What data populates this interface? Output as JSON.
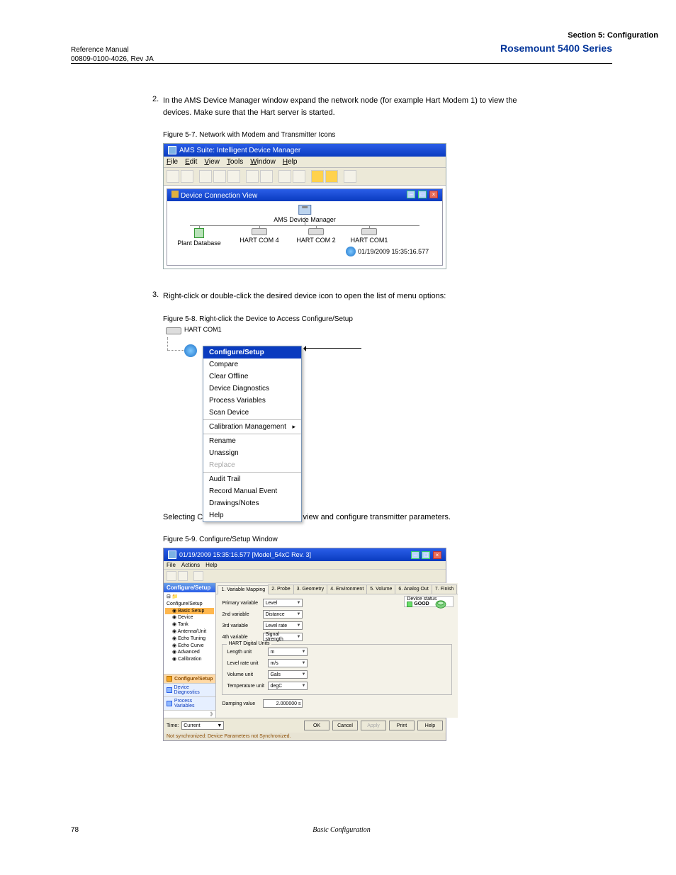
{
  "header": {
    "manual": "Reference Manual",
    "docid": "00809-0100-4026, Rev JA",
    "brand": "Rosemount 5400 Series",
    "section": "Section 5: Configuration"
  },
  "body": {
    "step2": "2.",
    "p1": "In the AMS Device Manager window expand the network node (for example Hart Modem 1) to view the devices. Make sure that the Hart server is started.",
    "figlabel1": "Figure 5-7. Network with Modem and Transmitter Icons",
    "step3": "3.",
    "p2": "Right-click or double-click the desired device icon to open the list of menu options:",
    "figlabel2": "Figure 5-8. Right-click the Device to Access Configure/Setup",
    "p3": "Selecting Configure/Setup allows you to view and configure transmitter parameters.",
    "figlabel3": "Figure 5-9. Configure/Setup Window"
  },
  "fig1": {
    "title": "AMS Suite: Intelligent Device Manager",
    "menus": [
      "File",
      "Edit",
      "View",
      "Tools",
      "Window",
      "Help"
    ],
    "inner_title": "Device Connection View",
    "root": "AMS Device Manager",
    "nodes": {
      "plantdb": "Plant Database",
      "com4": "HART COM 4",
      "com2": "HART COM 2",
      "com1": "HART COM1"
    },
    "device_ts": "01/19/2009 15:35:16.577"
  },
  "fig2": {
    "node_label": "HART COM1",
    "menu": {
      "configure": "Configure/Setup",
      "compare": "Compare",
      "clear": "Clear Offline",
      "diag": "Device Diagnostics",
      "procvar": "Process Variables",
      "scan": "Scan Device",
      "calib": "Calibration Management",
      "rename": "Rename",
      "unassign": "Unassign",
      "replace": "Replace",
      "audit": "Audit Trail",
      "record": "Record Manual Event",
      "drawings": "Drawings/Notes",
      "help": "Help"
    }
  },
  "fig3": {
    "title": "01/19/2009 15:35:16.577 [Model_54xC Rev. 3]",
    "menus": [
      "File",
      "Actions",
      "Help"
    ],
    "nav_header": "Configure/Setup",
    "nav_tree": {
      "root": "Configure/Setup",
      "basic": "Basic Setup",
      "items": [
        "Device",
        "Tank",
        "Antenna/Unit",
        "Echo Tuning",
        "Echo Curve",
        "Advanced",
        "Calibration"
      ]
    },
    "nav_buttons": {
      "config": "Configure/Setup",
      "diag": "Device Diagnostics",
      "proc": "Process Variables"
    },
    "tabs": [
      "1. Variable Mapping",
      "2. Probe",
      "3. Geometry",
      "4. Environment",
      "5. Volume",
      "6. Analog Out",
      "7. Finish"
    ],
    "fields": {
      "primary": {
        "label": "Primary variable",
        "value": "Level"
      },
      "second": {
        "label": "2nd variable",
        "value": "Distance"
      },
      "third": {
        "label": "3rd variable",
        "value": "Level rate"
      },
      "fourth": {
        "label": "4th variable",
        "value": "Signal strength"
      }
    },
    "group_label": "HART Digital Units",
    "units": {
      "length": {
        "label": "Length unit",
        "value": "m"
      },
      "levelrate": {
        "label": "Level rate unit",
        "value": "m/s"
      },
      "volume": {
        "label": "Volume unit",
        "value": "Gals"
      },
      "temp": {
        "label": "Temperature unit",
        "value": "degC"
      }
    },
    "damping": {
      "label": "Damping value",
      "value": "2.000000 s"
    },
    "status": {
      "label": "Device status",
      "value": "GOOD"
    },
    "time": {
      "label": "Time:",
      "value": "Current"
    },
    "buttons": {
      "ok": "OK",
      "cancel": "Cancel",
      "apply": "Apply",
      "print": "Print",
      "help": "Help"
    },
    "status_strip": "Not synchronized: Device Parameters not Synchronized."
  },
  "footer": {
    "page": "78",
    "section_name": "Basic Configuration"
  }
}
